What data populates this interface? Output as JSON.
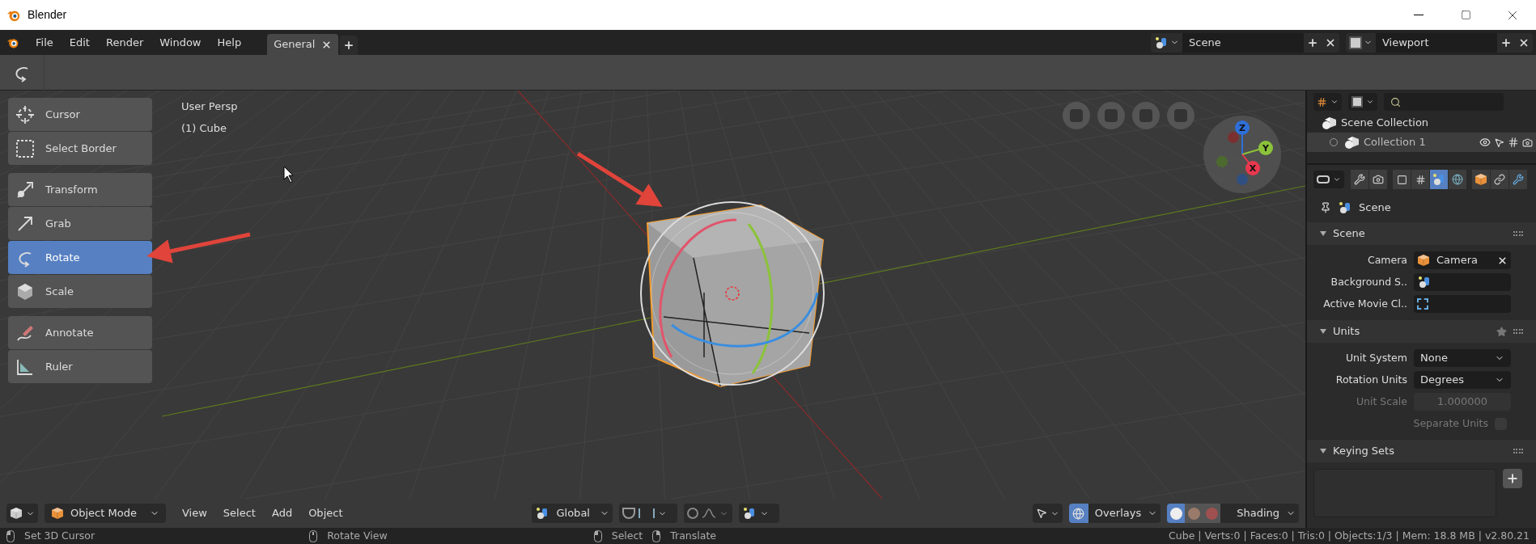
{
  "window": {
    "title": "Blender"
  },
  "menu": [
    {
      "label": "File"
    },
    {
      "label": "Edit"
    },
    {
      "label": "Render"
    },
    {
      "label": "Window"
    },
    {
      "label": "Help"
    }
  ],
  "workspace_tabs": [
    {
      "label": "General",
      "selected": true
    }
  ],
  "scene_selector": {
    "value": "Scene"
  },
  "view_layer_selector": {
    "value": "Viewport"
  },
  "toolbar_groups": [
    {
      "tools": [
        {
          "kind": "cursor",
          "label": "Cursor",
          "selected": false
        },
        {
          "kind": "select",
          "label": "Select Border",
          "selected": false
        }
      ]
    },
    {
      "tools": [
        {
          "kind": "transform",
          "label": "Transform",
          "selected": false
        },
        {
          "kind": "grab",
          "label": "Grab",
          "selected": false
        },
        {
          "kind": "rotate",
          "label": "Rotate",
          "selected": true
        },
        {
          "kind": "scale",
          "label": "Scale",
          "selected": false
        }
      ]
    },
    {
      "tools": [
        {
          "kind": "annotate",
          "label": "Annotate",
          "selected": false
        },
        {
          "kind": "ruler",
          "label": "Ruler",
          "selected": false
        }
      ]
    }
  ],
  "viewport": {
    "view_name": "User Persp",
    "object_name": "(1) Cube",
    "gizmo_axes": [
      {
        "label": "Z",
        "color": "#2f6fd8"
      },
      {
        "label": "Y",
        "color": "#8bc33a"
      },
      {
        "label": "X",
        "color": "#e8384f"
      }
    ]
  },
  "viewport_header": {
    "gizmos_on": false,
    "proportional_edit_on": false,
    "mode": "Object Mode",
    "menus": [
      "View",
      "Select",
      "Add",
      "Object"
    ],
    "orientation": "Global",
    "overlays": "Overlays",
    "shading": "Shading",
    "shading_modes": [
      {
        "selected": true
      },
      {
        "selected": false
      },
      {
        "selected": false
      }
    ]
  },
  "outliner": {
    "root": "Scene Collection",
    "collections": [
      {
        "label": "Collection 1",
        "selected": true
      }
    ]
  },
  "properties": {
    "tabs": [
      {
        "kind": "tool",
        "selected": false
      },
      {
        "kind": "render",
        "selected": false
      },
      {
        "kind": "output",
        "selected": false
      },
      {
        "kind": "view_layer",
        "selected": false
      },
      {
        "kind": "scene",
        "selected": true
      },
      {
        "kind": "world",
        "selected": false
      },
      {
        "kind": "object",
        "selected": false
      },
      {
        "kind": "constraint",
        "selected": false
      },
      {
        "kind": "modifier",
        "selected": false
      }
    ],
    "context": "Scene",
    "panels": [
      {
        "title": "Scene",
        "expanded": true,
        "rows": [
          {
            "kind": "object",
            "label": "Camera",
            "value": "Camera"
          },
          {
            "kind": "object",
            "label": "Background S.."
          },
          {
            "kind": "object",
            "label": "Active Movie Cl.."
          }
        ]
      },
      {
        "title": "Units",
        "expanded": true,
        "rows": [
          {
            "kind": "dropdown",
            "label": "Unit System",
            "value": "None",
            "disabled": false
          },
          {
            "kind": "dropdown",
            "label": "Rotation Units",
            "value": "Degrees",
            "disabled": false
          },
          {
            "kind": "number",
            "label": "Unit Scale",
            "value": "1.000000",
            "disabled": true
          },
          {
            "kind": "checkbox",
            "label": "Separate Units",
            "checked": false,
            "disabled": true
          }
        ]
      },
      {
        "title": "Keying Sets",
        "expanded": true,
        "rows": [
          {
            "kind": "list"
          }
        ]
      }
    ]
  },
  "status_bar": {
    "hints": [
      {
        "label": "Set 3D Cursor"
      },
      {
        "label": "Rotate View"
      },
      {
        "label": "Select"
      },
      {
        "label": "Translate"
      }
    ],
    "stats": "Cube | Verts:0 | Faces:0 | Tris:0 | Objects:1/3 | Mem: 18.8 MB | v2.80.21"
  }
}
